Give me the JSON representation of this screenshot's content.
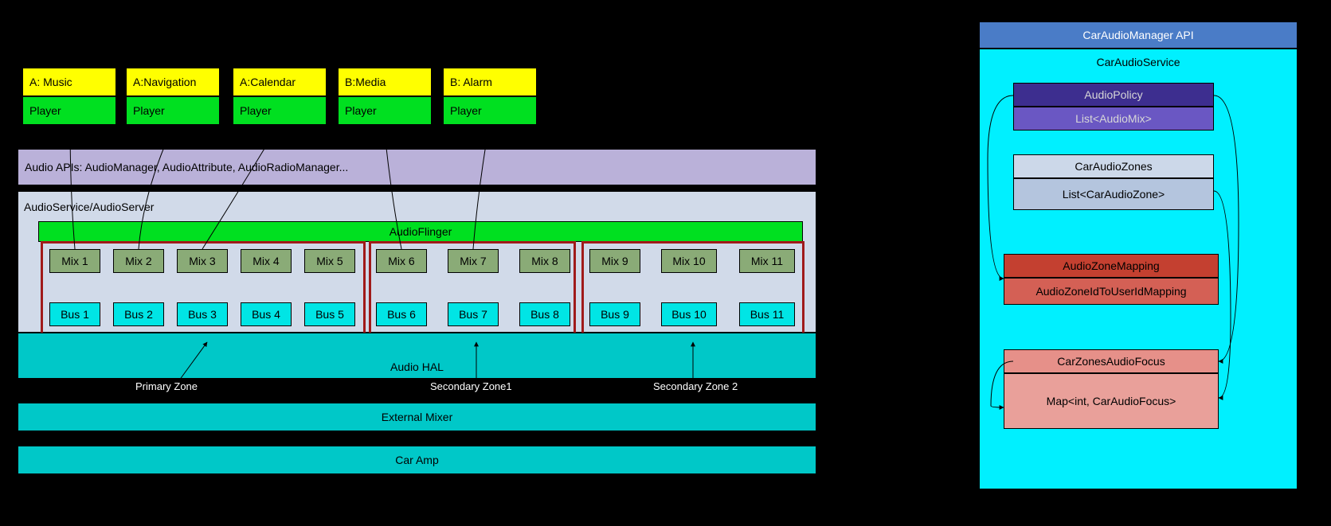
{
  "apps": [
    {
      "attr": "A: Music",
      "player": "Player"
    },
    {
      "attr": "A:Navigation",
      "player": "Player"
    },
    {
      "attr": "A:Calendar",
      "player": "Player"
    },
    {
      "attr": "B:Media",
      "player": "Player"
    },
    {
      "attr": "B: Alarm",
      "player": "Player"
    }
  ],
  "audio_apis": "Audio APIs: AudioManager, AudioAttribute, AudioRadioManager...",
  "audio_service": "AudioService/AudioServer",
  "audio_flinger": "AudioFlinger",
  "mixes": [
    "Mix 1",
    "Mix 2",
    "Mix 3",
    "Mix 4",
    "Mix 5",
    "Mix 6",
    "Mix 7",
    "Mix 8",
    "Mix 9",
    "Mix 10",
    "Mix 11"
  ],
  "buses": [
    "Bus 1",
    "Bus 2",
    "Bus 3",
    "Bus 4",
    "Bus 5",
    "Bus 6",
    "Bus 7",
    "Bus 8",
    "Bus 9",
    "Bus 10",
    "Bus 11"
  ],
  "audio_hal": "Audio HAL",
  "external_mixer": "External Mixer",
  "car_amp": "Car Amp",
  "zone_labels": {
    "primary": "Primary Zone",
    "secondary1": "Secondary Zone1",
    "secondary2": "Secondary Zone 2"
  },
  "right": {
    "api": "CarAudioManager API",
    "service": "CarAudioService",
    "policy": "AudioPolicy",
    "audiomix_list": "List<AudioMix>",
    "zones": "CarAudioZones",
    "zone_list": "List<CarAudioZone>",
    "mapping": "AudioZoneMapping",
    "mapping_detail": "AudioZoneIdToUserIdMapping",
    "focus": "CarZonesAudioFocus",
    "focus_map": "Map<int, CarAudioFocus>"
  }
}
